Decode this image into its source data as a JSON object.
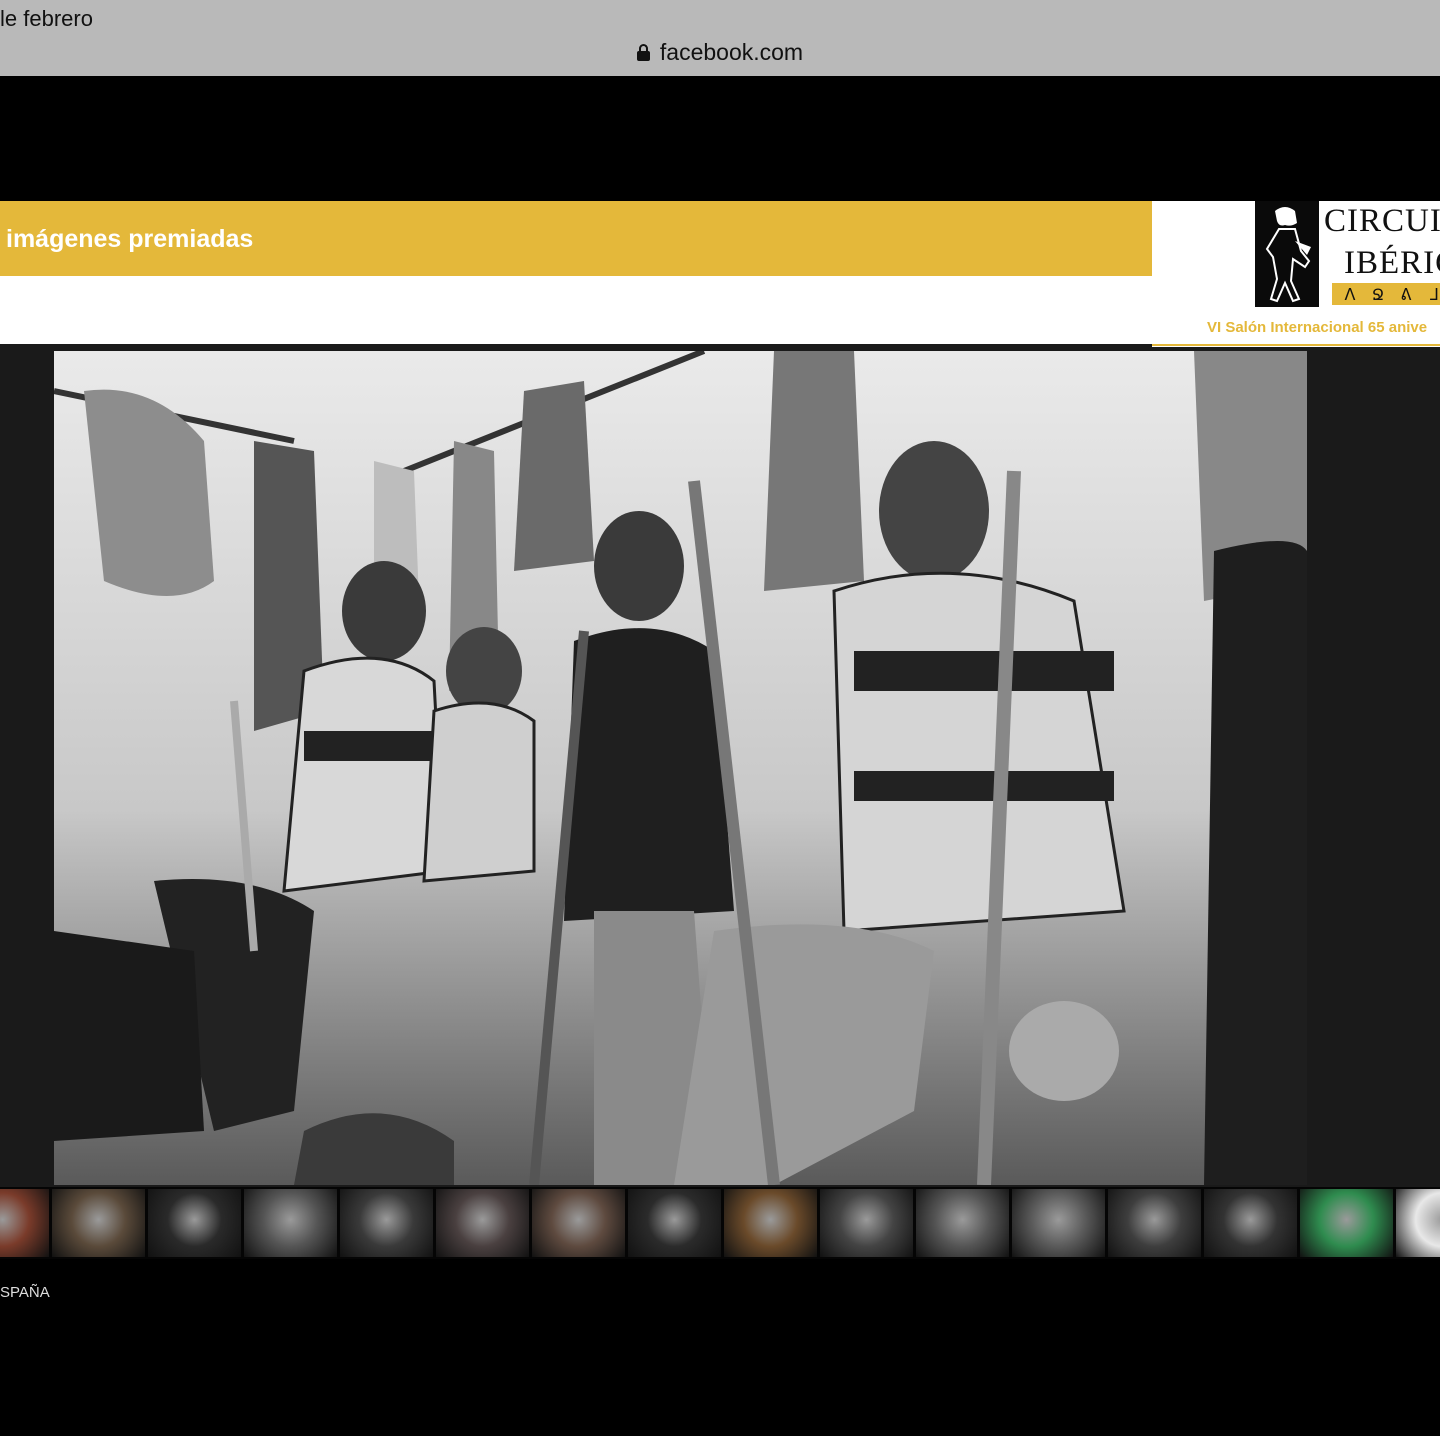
{
  "browser": {
    "tab_title": "le febrero",
    "url": "facebook.com"
  },
  "header": {
    "banner_title": "imágenes premiadas"
  },
  "logo": {
    "line1": "CIRCUIT",
    "line2": "IBÉRIC",
    "glyphs": [
      "ᐱ",
      "Ջ",
      "ᕕ",
      "ᒧ"
    ],
    "tagline": "VI Salón Internacional 65 anive"
  },
  "main_photo": {
    "alt": "Black and white photo of amputee football players seated in a locker room with crutches"
  },
  "thumbnails": [
    {
      "color": "#7a3b2a"
    },
    {
      "color": "#5a4a3a"
    },
    {
      "color": "#2a2a2a"
    },
    {
      "color": "#555"
    },
    {
      "color": "#3a3a3a"
    },
    {
      "color": "#4a4040"
    },
    {
      "color": "#5e4a3f"
    },
    {
      "color": "#2b2b2b"
    },
    {
      "color": "#6a4a2a"
    },
    {
      "color": "#444"
    },
    {
      "color": "#555"
    },
    {
      "color": "#5a5a5a"
    },
    {
      "color": "#3e3e3e"
    },
    {
      "color": "#333"
    },
    {
      "color": "#2f8c4f"
    },
    {
      "color": "#e8e8e8"
    }
  ],
  "footer": {
    "label": "SPAÑA"
  }
}
